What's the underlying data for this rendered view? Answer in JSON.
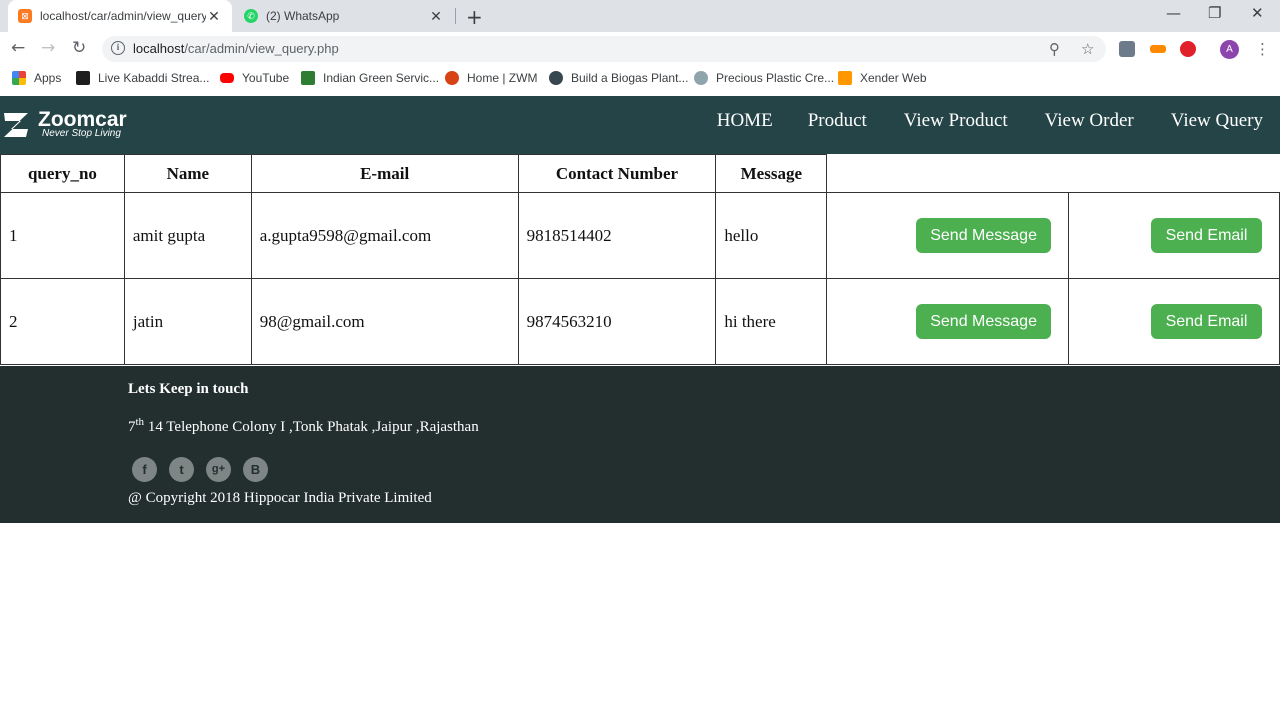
{
  "browser": {
    "tabs": [
      {
        "title": "localhost/car/admin/view_query.",
        "close": "✕"
      },
      {
        "title": "(2) WhatsApp",
        "close": "✕"
      }
    ],
    "new_tab": "+",
    "window_controls": {
      "minimize": "—",
      "restore": "❐",
      "close": "✕"
    },
    "url_host": "localhost",
    "url_path": "/car/admin/view_query.php",
    "bookmarks": [
      {
        "label": "Apps",
        "color": "#e8453c"
      },
      {
        "label": "Live Kabaddi Strea...",
        "color": "#1e1e1e"
      },
      {
        "label": "YouTube",
        "color": "#ff0000"
      },
      {
        "label": "Indian Green Servic...",
        "color": "#2e7d32"
      },
      {
        "label": "Home | ZWM",
        "color": "#d84315"
      },
      {
        "label": "Build a Biogas Plant...",
        "color": "#37474f"
      },
      {
        "label": "Precious Plastic Cre...",
        "color": "#90a4ae"
      },
      {
        "label": "Xender Web",
        "color": "#ff9800"
      }
    ],
    "avatar_letter": "A"
  },
  "site": {
    "brand": "Zoomcar",
    "tagline": "Never Stop Living",
    "nav": [
      "HOME",
      "Product",
      "View Product",
      "View Order",
      "View Query"
    ]
  },
  "table": {
    "headers": [
      "query_no",
      "Name",
      "E-mail",
      "Contact Number",
      "Message"
    ],
    "rows": [
      {
        "query_no": "1",
        "name": "amit gupta",
        "email": "a.gupta9598@gmail.com",
        "contact": "9818514402",
        "message": "hello",
        "btn_message": "Send Message",
        "btn_email": "Send Email"
      },
      {
        "query_no": "2",
        "name": "jatin",
        "email": "98@gmail.com",
        "contact": "9874563210",
        "message": "hi there",
        "btn_message": "Send Message",
        "btn_email": "Send Email"
      }
    ]
  },
  "footer": {
    "title": "Lets Keep in touch",
    "addr_num": "7",
    "addr_sup": "th",
    "addr_rest": " 14 Telephone Colony I ,Tonk Phatak ,Jaipur ,Rajasthan",
    "social": [
      "f",
      "t",
      "g+",
      "B"
    ],
    "copyright": "@ Copyright 2018 Hippocar India Private Limited"
  },
  "colors": {
    "header_bg": "#244447",
    "footer_bg": "#232f2f",
    "button_green": "#4caf50"
  }
}
